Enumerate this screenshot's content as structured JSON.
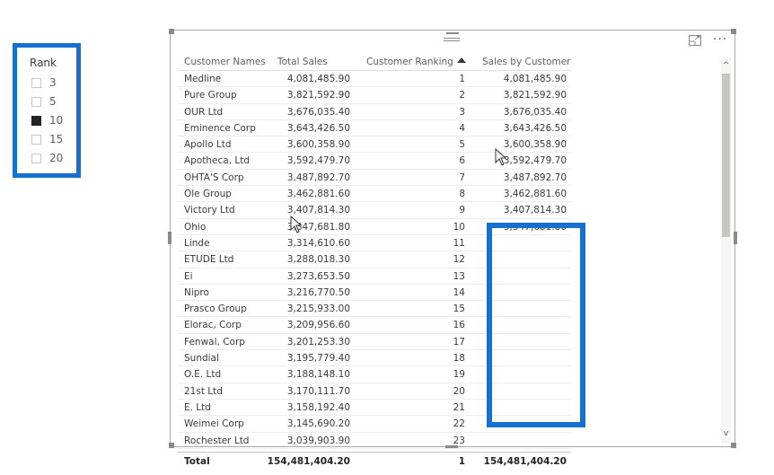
{
  "slicer": {
    "title": "Rank",
    "items": [
      {
        "label": "3",
        "checked": false
      },
      {
        "label": "5",
        "checked": false
      },
      {
        "label": "10",
        "checked": true
      },
      {
        "label": "15",
        "checked": false
      },
      {
        "label": "20",
        "checked": false
      }
    ]
  },
  "visual": {
    "focus_icon": "focus-mode-icon",
    "more_icon": "more-options-icon",
    "more_label": "···"
  },
  "table": {
    "headers": {
      "name": "Customer Names",
      "sales": "Total Sales",
      "rank": "Customer Ranking",
      "sbc": "Sales by Customer"
    },
    "sort": {
      "column": "Customer Ranking",
      "direction": "ascending"
    },
    "rows": [
      {
        "name": "Medline",
        "sales": "4,081,485.90",
        "rank": "1",
        "sbc": "4,081,485.90"
      },
      {
        "name": "Pure Group",
        "sales": "3,821,592.90",
        "rank": "2",
        "sbc": "3,821,592.90"
      },
      {
        "name": "OUR Ltd",
        "sales": "3,676,035.40",
        "rank": "3",
        "sbc": "3,676,035.40"
      },
      {
        "name": "Eminence Corp",
        "sales": "3,643,426.50",
        "rank": "4",
        "sbc": "3,643,426.50"
      },
      {
        "name": "Apollo Ltd",
        "sales": "3,600,358.90",
        "rank": "5",
        "sbc": "3,600,358.90"
      },
      {
        "name": "Apotheca, Ltd",
        "sales": "3,592,479.70",
        "rank": "6",
        "sbc": "3,592,479.70"
      },
      {
        "name": "OHTA'S Corp",
        "sales": "3,487,892.70",
        "rank": "7",
        "sbc": "3,487,892.70"
      },
      {
        "name": "Ole Group",
        "sales": "3,462,881.60",
        "rank": "8",
        "sbc": "3,462,881.60"
      },
      {
        "name": "Victory Ltd",
        "sales": "3,407,814.30",
        "rank": "9",
        "sbc": "3,407,814.30"
      },
      {
        "name": "Ohio",
        "sales": "3,347,681.80",
        "rank": "10",
        "sbc": "3,347,681.80"
      },
      {
        "name": "Linde",
        "sales": "3,314,610.60",
        "rank": "11",
        "sbc": ""
      },
      {
        "name": "ETUDE Ltd",
        "sales": "3,288,018.30",
        "rank": "12",
        "sbc": ""
      },
      {
        "name": "Ei",
        "sales": "3,273,653.50",
        "rank": "13",
        "sbc": ""
      },
      {
        "name": "Nipro",
        "sales": "3,216,770.50",
        "rank": "14",
        "sbc": ""
      },
      {
        "name": "Prasco Group",
        "sales": "3,215,933.00",
        "rank": "15",
        "sbc": ""
      },
      {
        "name": "Elorac, Corp",
        "sales": "3,209,956.60",
        "rank": "16",
        "sbc": ""
      },
      {
        "name": "Fenwal, Corp",
        "sales": "3,201,253.30",
        "rank": "17",
        "sbc": ""
      },
      {
        "name": "Sundial",
        "sales": "3,195,779.40",
        "rank": "18",
        "sbc": ""
      },
      {
        "name": "O.E. Ltd",
        "sales": "3,188,148.10",
        "rank": "19",
        "sbc": ""
      },
      {
        "name": "21st Ltd",
        "sales": "3,170,111.70",
        "rank": "20",
        "sbc": ""
      },
      {
        "name": "E. Ltd",
        "sales": "3,158,192.40",
        "rank": "21",
        "sbc": ""
      },
      {
        "name": "Weimei Corp",
        "sales": "3,145,690.20",
        "rank": "22",
        "sbc": ""
      },
      {
        "name": "Rochester Ltd",
        "sales": "3,039,903.90",
        "rank": "23",
        "sbc": ""
      }
    ],
    "total": {
      "label": "Total",
      "sales": "154,481,404.20",
      "rank": "1",
      "sbc": "154,481,404.20"
    }
  },
  "scrollbar": {
    "up": "^",
    "down": "v"
  },
  "colors": {
    "highlight": "#1570cf",
    "checked": "#252423"
  }
}
